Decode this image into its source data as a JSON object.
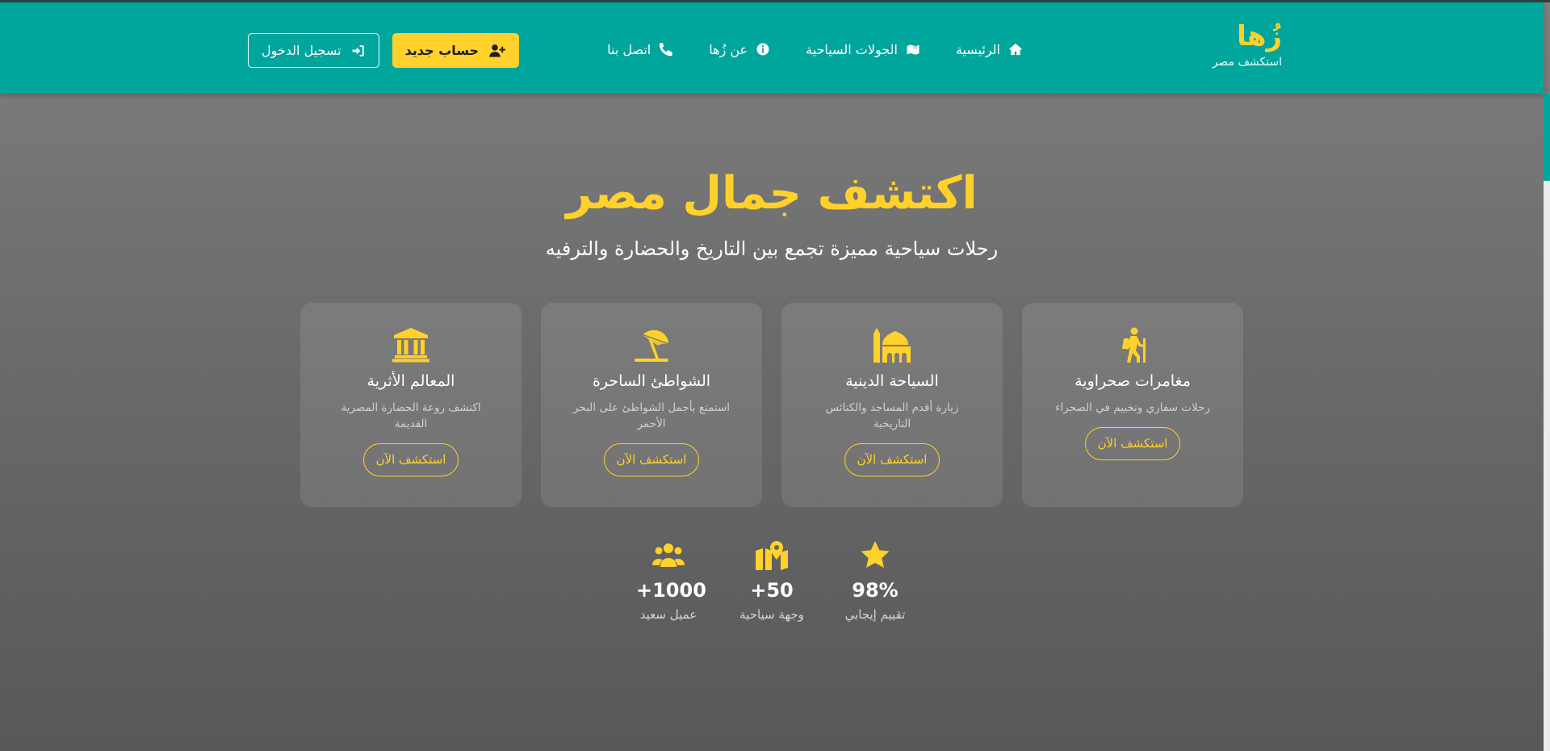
{
  "brand": {
    "name": "زُها",
    "tagline": "استكشف مصر"
  },
  "nav": {
    "items": [
      {
        "label": "الرئيسية",
        "icon": "home-icon"
      },
      {
        "label": "الجولات السياحية",
        "icon": "map-location-icon"
      },
      {
        "label": "عن زُها",
        "icon": "info-circle-icon"
      },
      {
        "label": "اتصل بنا",
        "icon": "phone-icon"
      }
    ],
    "login_label": "تسجيل الدخول",
    "register_label": "حساب جديد"
  },
  "hero": {
    "title": "اكتشف جمال مصر",
    "subtitle": "رحلات سياحية مميزة تجمع بين التاريخ والحضارة والترفيه"
  },
  "cards": [
    {
      "title": "المعالم الأثرية",
      "description": "اكتشف روعة الحضارة المصرية القديمة",
      "button": "استكشف الآن",
      "icon": "landmark-icon"
    },
    {
      "title": "الشواطئ الساحرة",
      "description": "استمتع بأجمل الشواطئ على البحر الأحمر",
      "button": "استكشف الآن",
      "icon": "umbrella-beach-icon"
    },
    {
      "title": "السياحة الدينية",
      "description": "زيارة أقدم المساجد والكنائس التاريخية",
      "button": "استكشف الآن",
      "icon": "mosque-icon"
    },
    {
      "title": "مغامرات صحراوية",
      "description": "رحلات سفاري وتخييم في الصحراء",
      "button": "استكشف الآن",
      "icon": "hiking-icon"
    }
  ],
  "stats": [
    {
      "value": "+1000",
      "label": "عميل سعيد",
      "icon": "users-icon"
    },
    {
      "value": "+50",
      "label": "وجهة سياحية",
      "icon": "map-marked-icon"
    },
    {
      "value": "98%",
      "label": "تقييم إيجابي",
      "icon": "star-icon"
    }
  ],
  "colors": {
    "nav_bg": "#00a59c",
    "accent": "#ffd12a",
    "text": "#ffffff"
  }
}
